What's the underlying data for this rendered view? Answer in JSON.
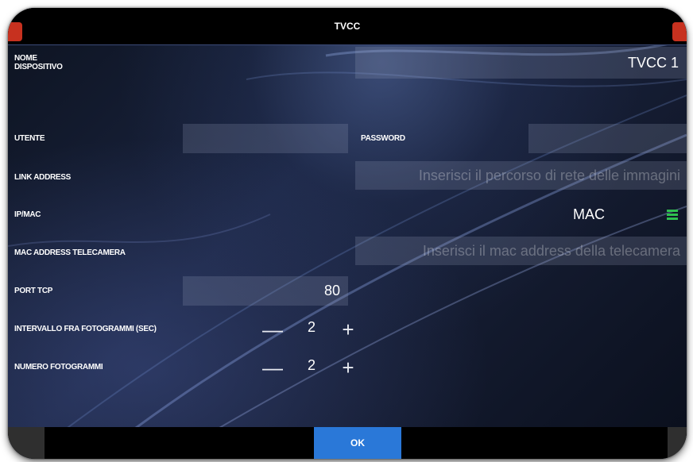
{
  "header": {
    "title": "TVCC"
  },
  "form": {
    "device_name": {
      "label": "NOME DISPOSITIVO",
      "value": "TVCC 1"
    },
    "user": {
      "label": "UTENTE",
      "value": ""
    },
    "password": {
      "label": "PASSWORD",
      "value": ""
    },
    "link_address": {
      "label": "LINK ADDRESS",
      "placeholder": "Inserisci il percorso di rete delle immagini"
    },
    "ip_mac": {
      "label": "IP/MAC",
      "value": "MAC",
      "icon": "hamburger-menu-icon"
    },
    "mac_address": {
      "label": "MAC ADDRESS TELECAMERA",
      "placeholder": "Inserisci il mac address della telecamera"
    },
    "port_tcp": {
      "label": "PORT TCP",
      "value": "80"
    },
    "frame_interval": {
      "label": "INTERVALLO FRA FOTOGRAMMI (SEC)",
      "value": "2",
      "minus": "—",
      "plus": "+"
    },
    "frame_count": {
      "label": "NUMERO FOTOGRAMMI",
      "value": "2",
      "minus": "—",
      "plus": "+"
    }
  },
  "footer": {
    "ok_label": "OK"
  },
  "colors": {
    "accent_blue": "#2a78d8",
    "menu_green": "#2fbf4f",
    "corner_red": "#c7311f"
  }
}
